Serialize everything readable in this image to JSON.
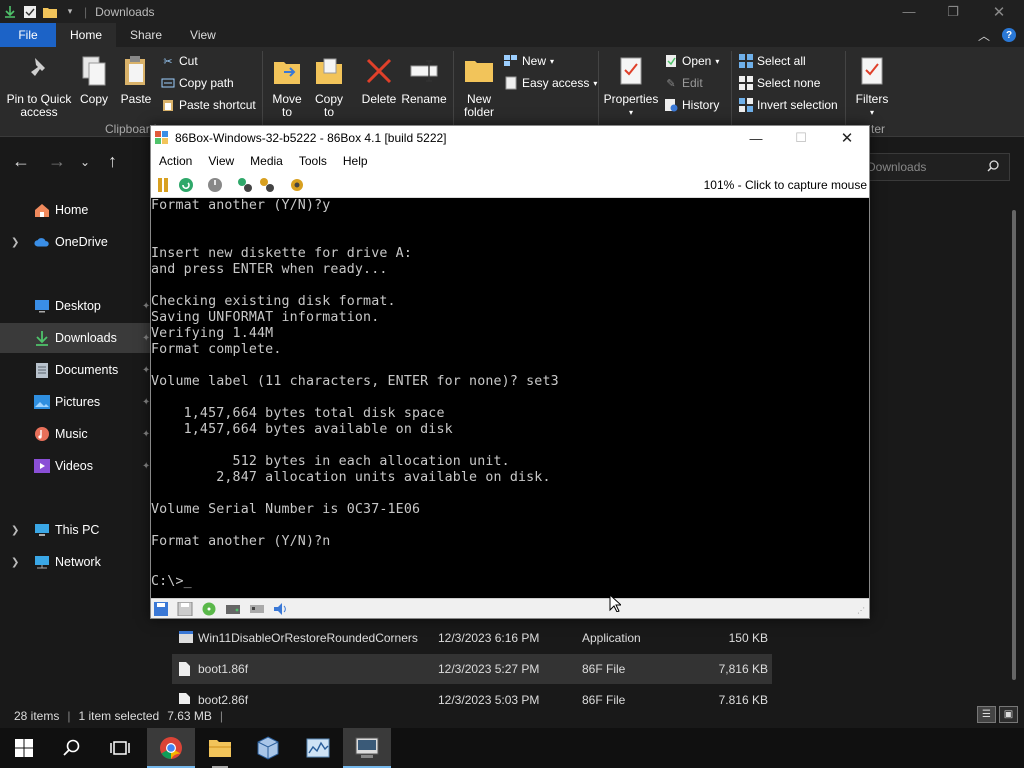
{
  "explorer": {
    "window_title": "Downloads",
    "tabs": {
      "file": "File",
      "home": "Home",
      "share": "Share",
      "view": "View"
    },
    "ribbon": {
      "pin_quick_access": "Pin to Quick\naccess",
      "copy": "Copy",
      "paste": "Paste",
      "cut": "Cut",
      "copy_path": "Copy path",
      "paste_shortcut": "Paste shortcut",
      "clipboard_group": "Clipboard",
      "move_to": "Move\nto",
      "copy_to": "Copy\nto",
      "delete": "Delete",
      "rename": "Rename",
      "new_folder": "New\nfolder",
      "new_item": "New",
      "easy_access": "Easy access",
      "properties": "Properties",
      "open": "Open",
      "edit": "Edit",
      "history": "History",
      "select_all": "Select all",
      "select_none": "Select none",
      "invert_selection": "Invert selection",
      "filters": "Filters",
      "filters_group_partial": "ter"
    },
    "search_placeholder": "Downloads",
    "sidebar": {
      "items": [
        {
          "label": "Home",
          "icon": "home-icon"
        },
        {
          "label": "OneDrive",
          "icon": "cloud-icon"
        },
        {
          "label": "Desktop",
          "icon": "desktop-icon"
        },
        {
          "label": "Downloads",
          "icon": "download-icon"
        },
        {
          "label": "Documents",
          "icon": "documents-icon"
        },
        {
          "label": "Pictures",
          "icon": "pictures-icon"
        },
        {
          "label": "Music",
          "icon": "music-icon"
        },
        {
          "label": "Videos",
          "icon": "videos-icon"
        },
        {
          "label": "This PC",
          "icon": "computer-icon"
        },
        {
          "label": "Network",
          "icon": "network-icon"
        }
      ]
    },
    "files": [
      {
        "name": "Win11DisableOrRestoreRoundedCorners",
        "date": "12/3/2023 6:16 PM",
        "type": "Application",
        "size": "150 KB"
      },
      {
        "name": "boot1.86f",
        "date": "12/3/2023 5:27 PM",
        "type": "86F File",
        "size": "7,816 KB"
      },
      {
        "name": "boot2.86f",
        "date": "12/3/2023 5:03 PM",
        "type": "86F File",
        "size": "7,816 KB"
      }
    ],
    "status": {
      "items": "28 items",
      "selected": "1 item selected",
      "size": "7.63 MB"
    }
  },
  "box86": {
    "title": "86Box-Windows-32-b5222 - 86Box 4.1 [build 5222]",
    "menu": [
      "Action",
      "View",
      "Media",
      "Tools",
      "Help"
    ],
    "capture_text": "101% - Click to capture mouse",
    "console_lines": [
      "Format another (Y/N)?y",
      "",
      "",
      "Insert new diskette for drive A:",
      "and press ENTER when ready...",
      "",
      "Checking existing disk format.",
      "Saving UNFORMAT information.",
      "Verifying 1.44M",
      "Format complete.",
      "",
      "Volume label (11 characters, ENTER for none)? set3",
      "",
      "    1,457,664 bytes total disk space",
      "    1,457,664 bytes available on disk",
      "",
      "          512 bytes in each allocation unit.",
      "        2,847 allocation units available on disk.",
      "",
      "Volume Serial Number is 0C37-1E06",
      "",
      "Format another (Y/N)?n",
      "",
      "",
      "C:\\>"
    ]
  },
  "colors": {
    "file_tab": "#1c63c7",
    "selection": "#3a3a3a",
    "console_text": "#c8c8c8"
  }
}
